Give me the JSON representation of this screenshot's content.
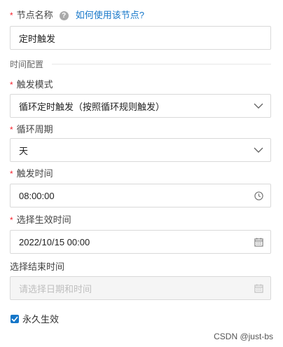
{
  "form": {
    "node_name": {
      "label": "节点名称",
      "help_link": "如何使用该节点?",
      "value": "定时触发"
    },
    "section_title": "时间配置",
    "trigger_mode": {
      "label": "触发模式",
      "value": "循环定时触发（按照循环规则触发）"
    },
    "cycle_period": {
      "label": "循环周期",
      "value": "天"
    },
    "trigger_time": {
      "label": "触发时间",
      "value": "08:00:00"
    },
    "start_time": {
      "label": "选择生效时间",
      "value": "2022/10/15 00:00"
    },
    "end_time": {
      "label": "选择结束时间",
      "placeholder": "请选择日期和时间"
    },
    "permanent": {
      "label": "永久生效",
      "checked": true
    }
  },
  "icons": {
    "help": "question-circle-icon",
    "select": "chevron-down-icon",
    "time": "clock-icon",
    "date": "calendar-icon"
  },
  "colors": {
    "required": "#f5222d",
    "link": "#1677c9",
    "checkbox": "#1677c9"
  },
  "watermark": "CSDN @just-bs"
}
